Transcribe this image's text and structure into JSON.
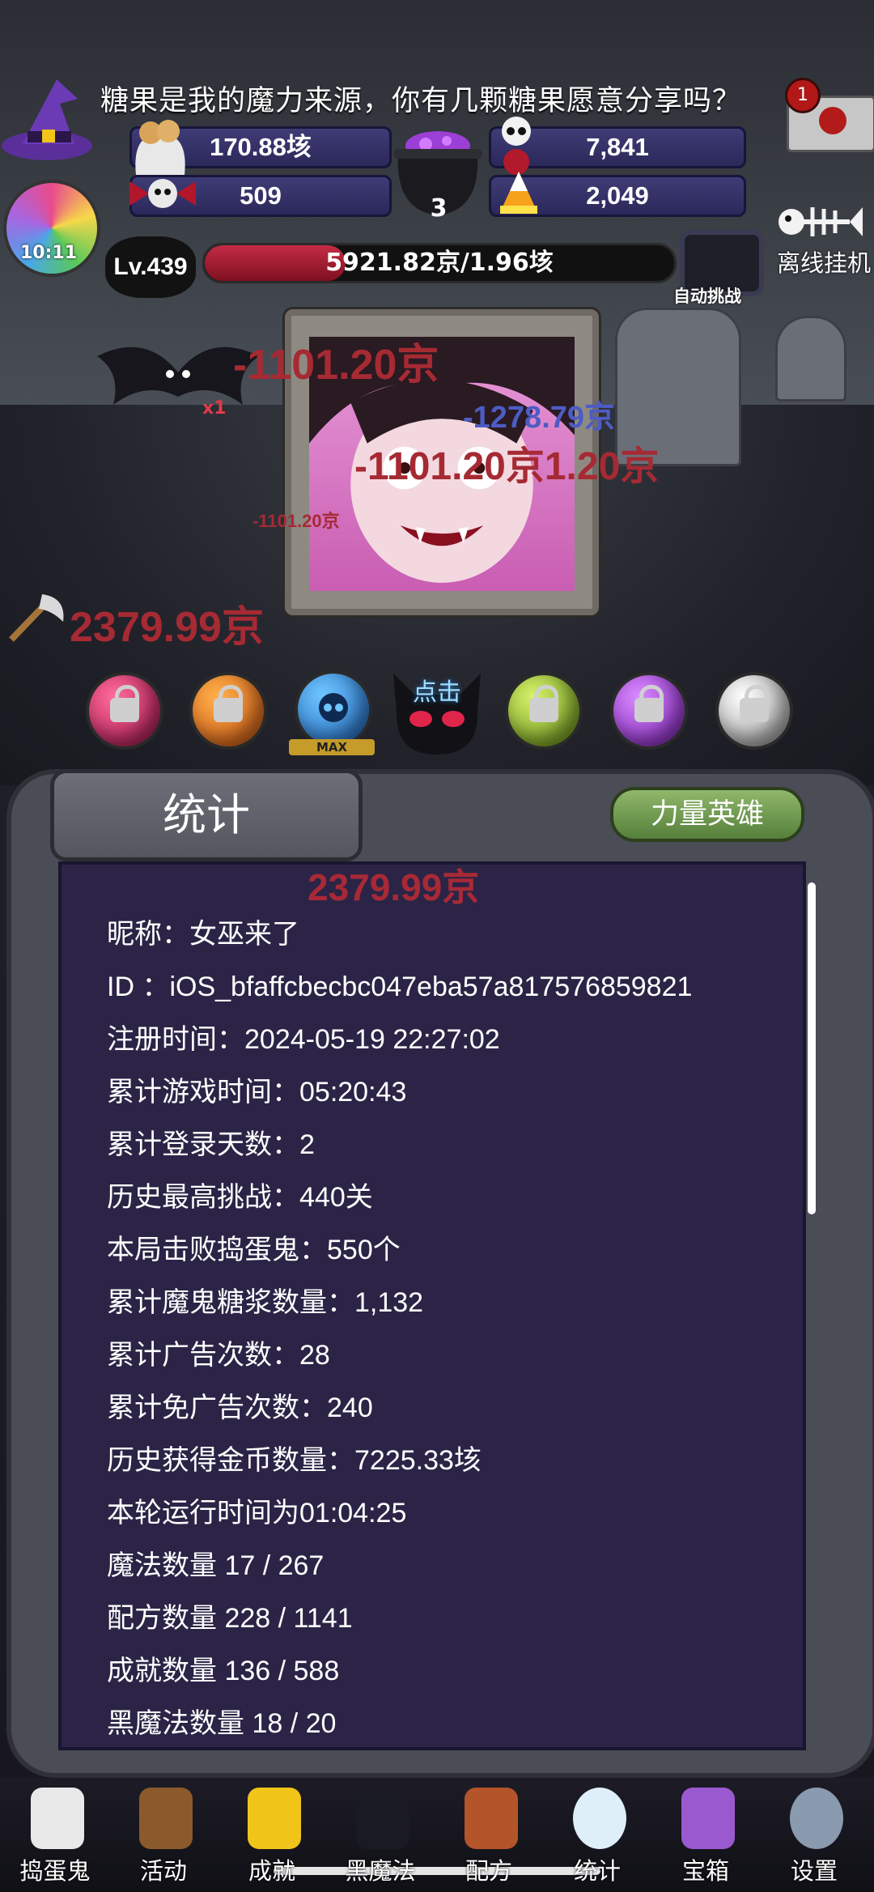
{
  "banner": {
    "message": "糖果是我的魔力来源，你有几颗糖果愿意分享吗？",
    "mail_badge": "1"
  },
  "resources": {
    "cookie": "170.88垓",
    "skull_potion": "7,841",
    "candy": "509",
    "candy_corn": "2,049",
    "cauldron": "3"
  },
  "lollipop_timer": "10:11",
  "level": {
    "label": "Lv.439"
  },
  "boss_hp": {
    "text": "5921.82京/1.96垓",
    "fraction": 0.3
  },
  "auto_challenge": "自动挑战",
  "offline": "离线挂机",
  "damage_texts": [
    "-1101.20京",
    "-1278.79京",
    "-1101.20京1.20京",
    "-1101.20京"
  ],
  "axe_damage": "2379.99京",
  "bat_multiplier": "x1",
  "slots": {
    "max_label": "MAX",
    "tap_label": "点击"
  },
  "panel": {
    "title": "统计",
    "hero_button": "力量英雄",
    "ghost_text": "2379.99京"
  },
  "stats": [
    "昵称：女巫来了",
    "ID ：iOS_bfaffcbecbc047eba57a817576859821",
    "注册时间：2024-05-19 22:27:02",
    "累计游戏时间：05:20:43",
    "累计登录天数：2",
    "历史最高挑战：440关",
    "本局击败捣蛋鬼：550个",
    "累计魔鬼糖浆数量：1,132",
    "累计广告次数：28",
    "累计免广告次数：240",
    "历史获得金币数量：7225.33垓",
    "本轮运行时间为01:04:25",
    "魔法数量 17 / 267",
    "配方数量 228 / 1141",
    "成就数量 136 / 588",
    "黑魔法数量 18 / 20"
  ],
  "nav": [
    "捣蛋鬼",
    "活动",
    "成就",
    "黑魔法",
    "配方",
    "统计",
    "宝箱",
    "设置"
  ],
  "colors": {
    "panel_bg": "#2b2446",
    "hero_button": "#6f9a4f",
    "damage_red": "#a62a33"
  }
}
